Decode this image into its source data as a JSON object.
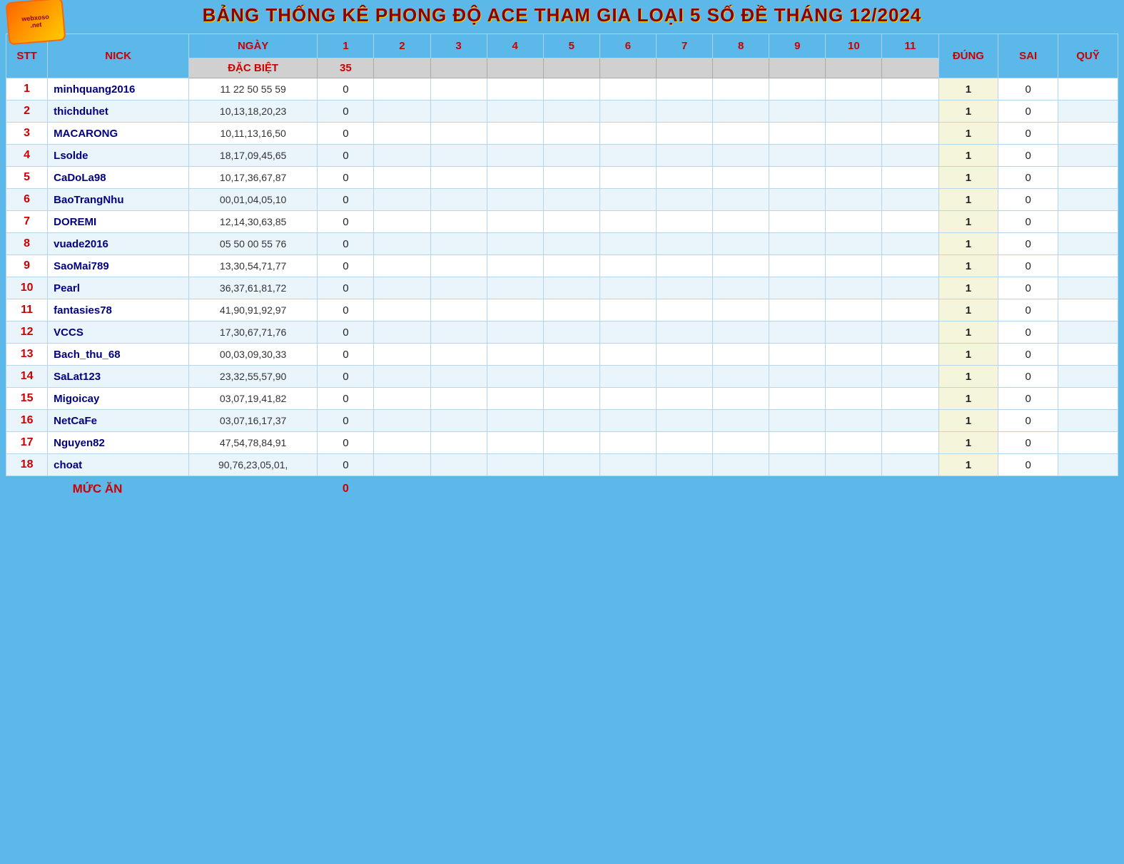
{
  "page": {
    "title": "BẢNG THỐNG KÊ PHONG ĐỘ ACE THAM GIA LOẠI 5 SỐ ĐỀ THÁNG 12/2024",
    "logo_line1": "webxoso",
    "logo_line2": ".net"
  },
  "header": {
    "stt": "STT",
    "nick": "NICK",
    "ngay": "NGÀY",
    "dacbiet": "ĐẶC BIỆT",
    "col1": "1",
    "col2": "2",
    "col3": "3",
    "col4": "4",
    "col5": "5",
    "col6": "6",
    "col7": "7",
    "col8": "8",
    "col9": "9",
    "col10": "10",
    "col11": "11",
    "dung": "ĐÚNG",
    "sai": "SAI",
    "quy": "QUỸ",
    "dacbiet_val": "35"
  },
  "rows": [
    {
      "stt": "1",
      "nick": "minhquang2016",
      "ngay": "11 22 50 55 59",
      "col1": "0",
      "dung": "1",
      "sai": "0"
    },
    {
      "stt": "2",
      "nick": "thichduhet",
      "ngay": "10,13,18,20,23",
      "col1": "0",
      "dung": "1",
      "sai": "0"
    },
    {
      "stt": "3",
      "nick": "MACARONG",
      "ngay": "10,11,13,16,50",
      "col1": "0",
      "dung": "1",
      "sai": "0"
    },
    {
      "stt": "4",
      "nick": "Lsolde",
      "ngay": "18,17,09,45,65",
      "col1": "0",
      "dung": "1",
      "sai": "0"
    },
    {
      "stt": "5",
      "nick": "CaDoLa98",
      "ngay": "10,17,36,67,87",
      "col1": "0",
      "dung": "1",
      "sai": "0"
    },
    {
      "stt": "6",
      "nick": "BaoTrangNhu",
      "ngay": "00,01,04,05,10",
      "col1": "0",
      "dung": "1",
      "sai": "0"
    },
    {
      "stt": "7",
      "nick": "DOREMI",
      "ngay": "12,14,30,63,85",
      "col1": "0",
      "dung": "1",
      "sai": "0"
    },
    {
      "stt": "8",
      "nick": "vuade2016",
      "ngay": "05 50 00 55 76",
      "col1": "0",
      "dung": "1",
      "sai": "0"
    },
    {
      "stt": "9",
      "nick": "SaoMai789",
      "ngay": "13,30,54,71,77",
      "col1": "0",
      "dung": "1",
      "sai": "0"
    },
    {
      "stt": "10",
      "nick": "Pearl",
      "ngay": "36,37,61,81,72",
      "col1": "0",
      "dung": "1",
      "sai": "0"
    },
    {
      "stt": "11",
      "nick": "fantasies78",
      "ngay": "41,90,91,92,97",
      "col1": "0",
      "dung": "1",
      "sai": "0"
    },
    {
      "stt": "12",
      "nick": "VCCS",
      "ngay": "17,30,67,71,76",
      "col1": "0",
      "dung": "1",
      "sai": "0"
    },
    {
      "stt": "13",
      "nick": "Bach_thu_68",
      "ngay": "00,03,09,30,33",
      "col1": "0",
      "dung": "1",
      "sai": "0"
    },
    {
      "stt": "14",
      "nick": "SaLat123",
      "ngay": "23,32,55,57,90",
      "col1": "0",
      "dung": "1",
      "sai": "0"
    },
    {
      "stt": "15",
      "nick": "Migoicay",
      "ngay": "03,07,19,41,82",
      "col1": "0",
      "dung": "1",
      "sai": "0"
    },
    {
      "stt": "16",
      "nick": "NetCaFe",
      "ngay": "03,07,16,17,37",
      "col1": "0",
      "dung": "1",
      "sai": "0"
    },
    {
      "stt": "17",
      "nick": "Nguyen82",
      "ngay": "47,54,78,84,91",
      "col1": "0",
      "dung": "1",
      "sai": "0"
    },
    {
      "stt": "18",
      "nick": "choat",
      "ngay": "90,76,23,05,01,",
      "col1": "0",
      "dung": "1",
      "sai": "0"
    }
  ],
  "footer": {
    "label": "MỨC ĂN",
    "value": "0"
  }
}
